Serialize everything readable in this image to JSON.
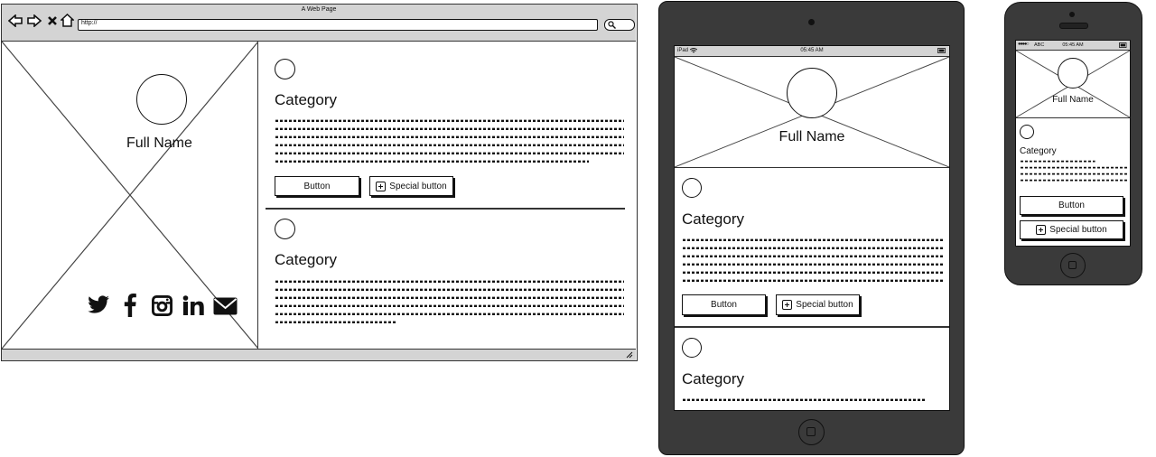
{
  "browser": {
    "title": "A Web Page",
    "url": "http://"
  },
  "profile": {
    "full_name": "Full Name"
  },
  "sections": [
    {
      "category": "Category",
      "button_label": "Button",
      "special_button_label": "Special button"
    },
    {
      "category": "Category"
    }
  ],
  "social_icons": [
    "twitter-icon",
    "facebook-icon",
    "instagram-icon",
    "linkedin-icon",
    "email-icon"
  ],
  "tablet": {
    "status_left": "iPad",
    "time": "05:45 AM",
    "full_name": "Full Name",
    "sections": [
      {
        "category": "Category",
        "button_label": "Button",
        "special_button_label": "Special button"
      },
      {
        "category": "Category"
      }
    ]
  },
  "phone": {
    "carrier": "ABC",
    "time": "05:45 AM",
    "full_name": "Full Name",
    "category": "Category",
    "button_label": "Button",
    "special_button_label": "Special button"
  },
  "colors": {
    "device_body": "#3a3a3a",
    "chrome_grey": "#d4d4d4",
    "ink": "#111111"
  }
}
